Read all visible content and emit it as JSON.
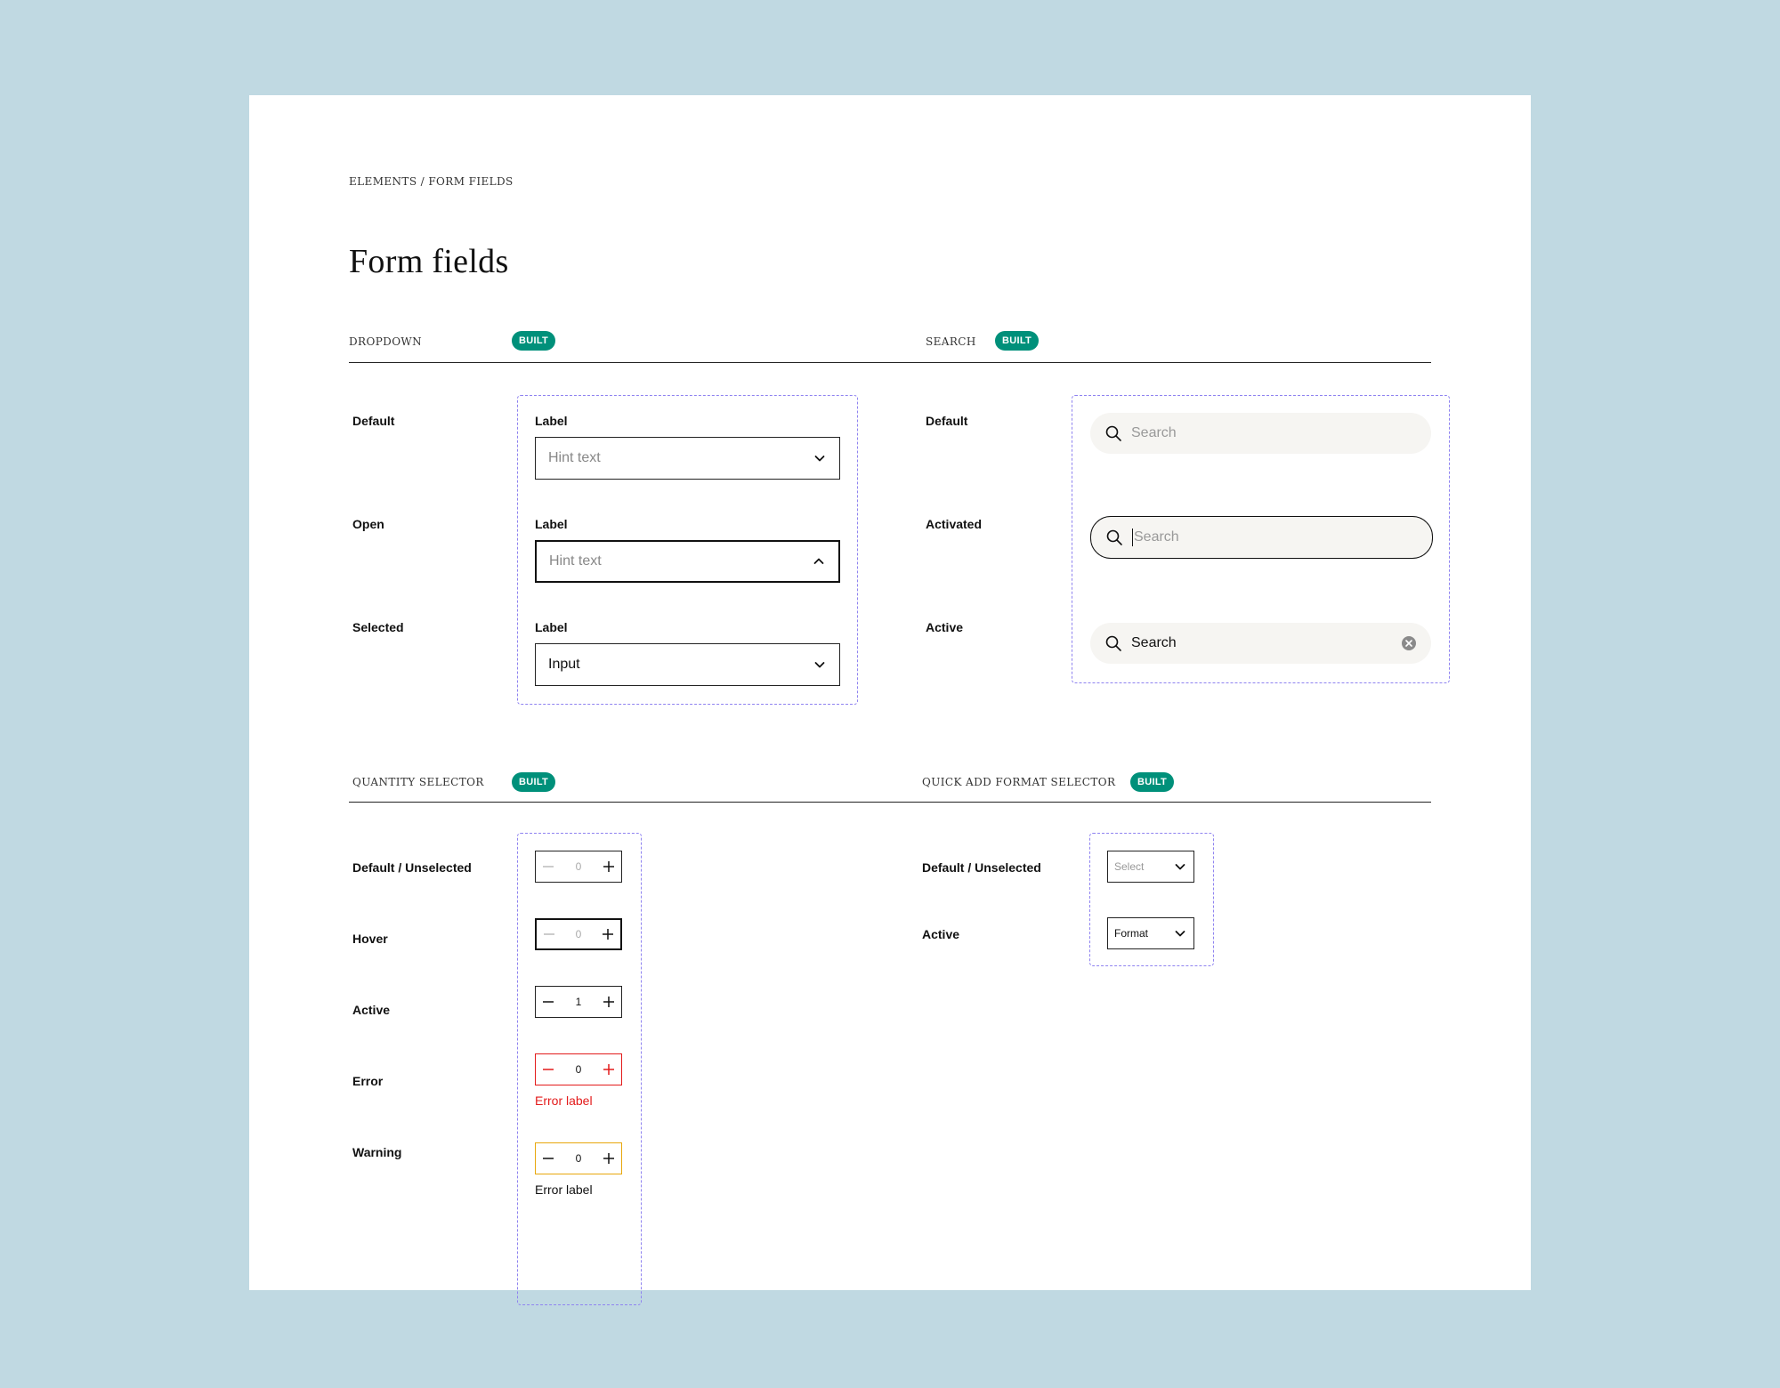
{
  "breadcrumb": "ELEMENTS / FORM FIELDS",
  "page_title": "Form fields",
  "colors": {
    "background": "#c0d9e2",
    "badge": "#00907a",
    "frame": "#8f83f0",
    "error": "#e31b1b",
    "warning": "#e8a70c"
  },
  "dropdown": {
    "title": "DROPDOWN",
    "badge": "BUILT",
    "rows": [
      {
        "state": "Default",
        "label": "Label",
        "text": "Hint text",
        "icon": "chevron-down-icon"
      },
      {
        "state": "Open",
        "label": "Label",
        "text": "Hint text",
        "icon": "chevron-up-icon"
      },
      {
        "state": "Selected",
        "label": "Label",
        "text": "Input",
        "icon": "chevron-down-icon"
      }
    ]
  },
  "search": {
    "title": "SEARCH",
    "badge": "BUILT",
    "rows": [
      {
        "state": "Default",
        "text": "Search"
      },
      {
        "state": "Activated",
        "text": "Search"
      },
      {
        "state": "Active",
        "text": "Search"
      }
    ]
  },
  "quantity": {
    "title": "QUANTITY SELECTOR",
    "badge": "BUILT",
    "rows": [
      {
        "state": "Default / Unselected",
        "value": "0"
      },
      {
        "state": "Hover",
        "value": "0"
      },
      {
        "state": "Active",
        "value": "1"
      },
      {
        "state": "Error",
        "value": "0",
        "message": "Error label"
      },
      {
        "state": "Warning",
        "value": "0",
        "message": "Error label"
      }
    ]
  },
  "format": {
    "title": "QUICK ADD FORMAT SELECTOR",
    "badge": "BUILT",
    "rows": [
      {
        "state": "Default / Unselected",
        "text": "Select"
      },
      {
        "state": "Active",
        "text": "Format"
      }
    ]
  }
}
